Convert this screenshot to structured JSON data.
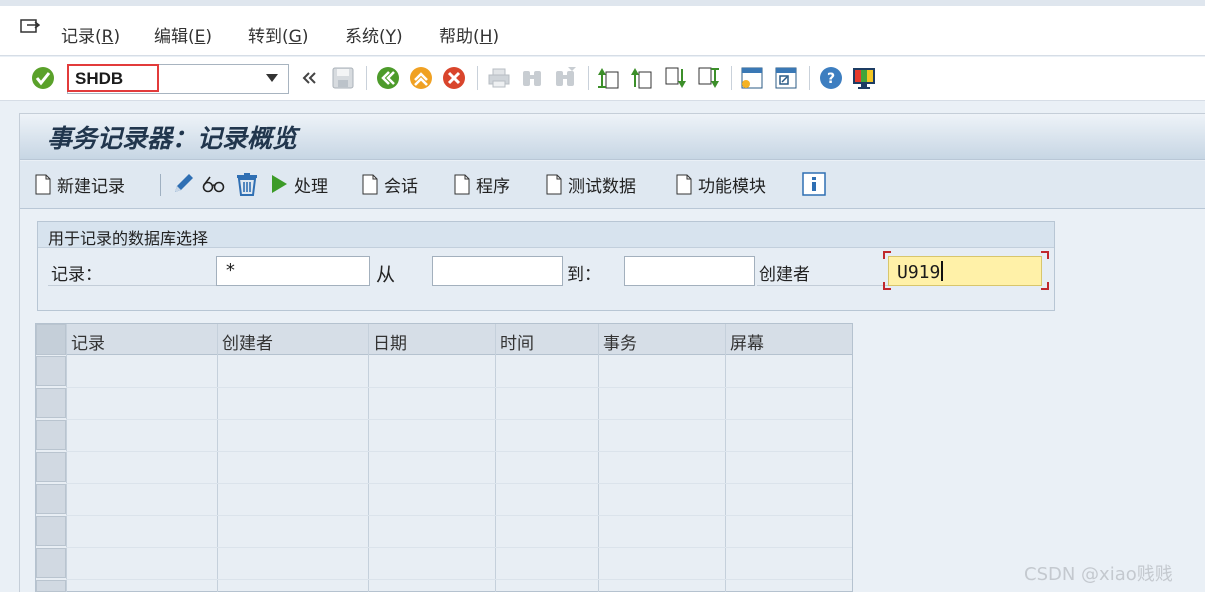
{
  "menu": {
    "items": [
      {
        "label": "记录",
        "key": "R"
      },
      {
        "label": "编辑",
        "key": "E"
      },
      {
        "label": "转到",
        "key": "G"
      },
      {
        "label": "系统",
        "key": "Y"
      },
      {
        "label": "帮助",
        "key": "H"
      }
    ]
  },
  "toolbar": {
    "command_value": "SHDB"
  },
  "page": {
    "title": "事务记录器：记录概览"
  },
  "app_toolbar": {
    "new_recording": "新建记录",
    "process": "处理",
    "session": "会话",
    "program": "程序",
    "test_data": "测试数据",
    "function_module": "功能模块"
  },
  "selection": {
    "group_title": "用于记录的数据库选择",
    "recording_label": "记录：",
    "recording_value": "*",
    "from_label": "从",
    "from_value": "",
    "to_label": "到：",
    "to_value": "",
    "creator_label": "创建者",
    "creator_value": "U919"
  },
  "table": {
    "columns": [
      "记录",
      "创建者",
      "日期",
      "时间",
      "事务",
      "屏幕"
    ],
    "rows": []
  },
  "watermark": "CSDN @xiao贱贱",
  "colors": {
    "highlight_border": "#e23b3b",
    "focus_field": "#fff1a8",
    "title_text": "#21364d"
  }
}
